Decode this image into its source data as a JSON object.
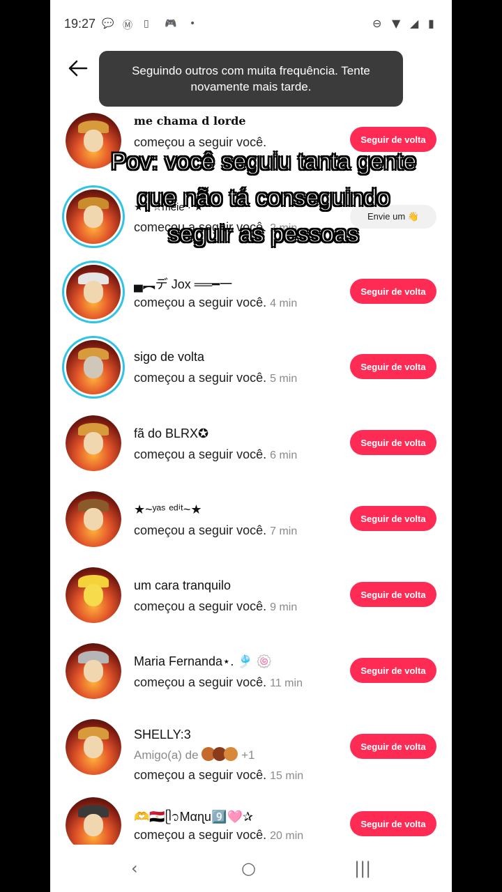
{
  "status": {
    "time": "19:27",
    "icons_left": [
      "chat-bubble-icon",
      "motorola-icon",
      "phone-icon",
      "gamepad-icon",
      "dot-icon"
    ],
    "icons_right": [
      "dnd-icon",
      "wifi-icon",
      "signal-icon",
      "battery-icon"
    ]
  },
  "header": {
    "back_icon": "arrow-left-icon"
  },
  "toast": {
    "text": "Seguindo outros com muita frequência. Tente novamente mais tarde."
  },
  "overlay": {
    "line1": "Pov: você seguiu tanta gente",
    "line2": "que não tá conseguindo",
    "line3": "seguir as pessoas"
  },
  "rows": [
    {
      "name": "me chama d lorde",
      "sub": "começou a seguir você.",
      "time": "",
      "button": "Seguir de volta"
    },
    {
      "name": "★ · ☆meie · ★",
      "sub": "começou a seguir você.",
      "time": "2 min",
      "button": "Envie um 👋"
    },
    {
      "name": "▄︻デ Jox ══━一",
      "sub": "começou a seguir você.",
      "time": "4 min",
      "button": "Seguir de volta"
    },
    {
      "name": "sigo de volta",
      "sub": "começou a seguir você.",
      "time": "5 min",
      "button": "Seguir de volta"
    },
    {
      "name": "fã do BLRX✪",
      "sub": "começou a seguir você.",
      "time": "6 min",
      "button": "Seguir de volta"
    },
    {
      "name": "★~ʸᵃˢ ᵉᵈⁱᵗ~★",
      "sub": "começou a seguir você.",
      "time": "7 min",
      "button": "Seguir de volta"
    },
    {
      "name": "um cara tranquilo",
      "sub": "começou a seguir você.",
      "time": "9 min",
      "button": "Seguir de volta"
    },
    {
      "name": "Maria Fernanda⋆. 🎐 🍥",
      "sub": "começou a seguir você.",
      "time": "11 min",
      "button": "Seguir de volta"
    },
    {
      "name": "SHELLY:3",
      "friend": "Amigo(a) de",
      "friend_extra": "+1",
      "sub": "começou a seguir você.",
      "time": "15 min",
      "button": "Seguir de volta"
    },
    {
      "name": "🫶🇪🇬ᥫ᭡Mαɳu9️⃣🩷✰",
      "sub": "começou a seguir você.",
      "time": "20 min",
      "button": "Seguir de volta"
    }
  ],
  "navbar": {
    "icons": [
      "back-triangle-icon",
      "home-circle-icon",
      "recents-icon"
    ]
  },
  "colors": {
    "accent": "#fe2c55",
    "ring": "#2fc3e8",
    "toast_bg": "#3b3b3b"
  }
}
